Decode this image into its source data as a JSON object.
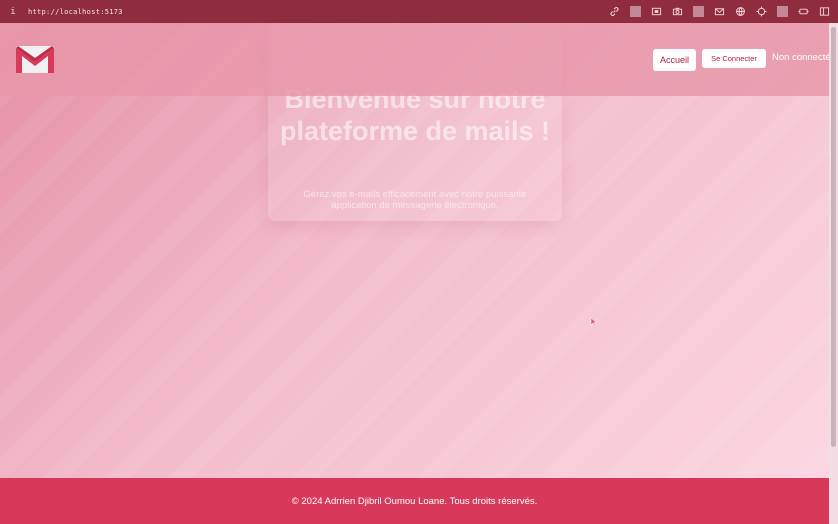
{
  "browser": {
    "url": "http://localhost:5173",
    "icons": [
      "link-icon",
      "screenshot-icon",
      "camera-icon",
      "mail-icon",
      "globe-icon",
      "crosshair-icon",
      "extension-icon",
      "sidebar-icon"
    ]
  },
  "header": {
    "nav": {
      "home_label": "Accueil",
      "login_label": "Se Connecter"
    },
    "status": "Non connecté"
  },
  "hero": {
    "title": "Bienvenue sur notre plateforme de mails !",
    "subtitle": "Gérez vos e-mails efficacement avec notre puissante application de messagerie électronique."
  },
  "footer": {
    "text": "© 2024 Adrrien Djibril Oumou Loane. Tous droits réservés."
  },
  "colors": {
    "brand": "#d8395a",
    "header_bg": "#e896aa",
    "browser_bar": "#8f2d3e"
  }
}
